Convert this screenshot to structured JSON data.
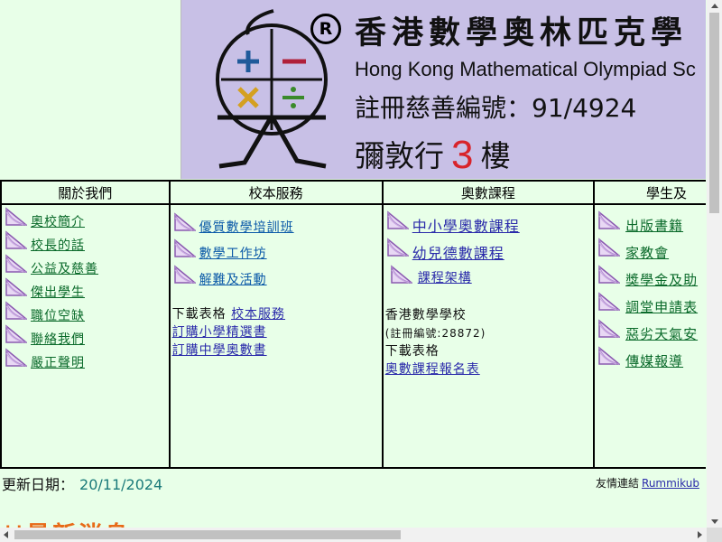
{
  "banner": {
    "reg_mark": "R",
    "title_zh": "香港數學奧林匹克學",
    "title_en": "Hong Kong Mathematical Olympiad Sc",
    "charity_no": "註冊慈善編號：91/4924",
    "floor_pre": "彌敦行",
    "floor_num": "3",
    "floor_post": "樓",
    "logo_colors": {
      "plus": "#1f5a9a",
      "minus": "#b0203a",
      "times": "#d4a020",
      "divide": "#3a8a2a"
    }
  },
  "menu": {
    "headers": [
      "關於我們",
      "校本服務",
      "奧數課程",
      "學生及"
    ],
    "about": [
      "奧校簡介",
      "校長的話",
      "公益及慈善",
      "傑出學生",
      "職位空缺",
      "聯絡我們",
      "嚴正聲明"
    ],
    "school": [
      "優質數學培訓班",
      "數學工作坊",
      "解難及活動"
    ],
    "school_download_label": "下載表格",
    "school_download_link": "校本服務",
    "school_order_primary": "訂購小學精選書",
    "school_order_secondary": "訂購中學奧數書",
    "courses": [
      "中小學奧數課程",
      "幼兒德數課程",
      "課程架構"
    ],
    "courses_school_name": "香港數學學校",
    "courses_reg_no": "(註冊編號:28872)",
    "courses_download_label": "下載表格",
    "courses_form_link": "奧數課程報名表",
    "students": [
      "出版書籍",
      "家教會",
      "獎學金及助",
      "調堂申請表",
      "惡劣天氣安",
      "傳媒報導"
    ]
  },
  "footer": {
    "updated_label": "更新日期：",
    "updated_date": "20/11/2024",
    "friends_label": "友情連結",
    "friends_link": "Rummikub",
    "latest_news": "||最新消息"
  }
}
